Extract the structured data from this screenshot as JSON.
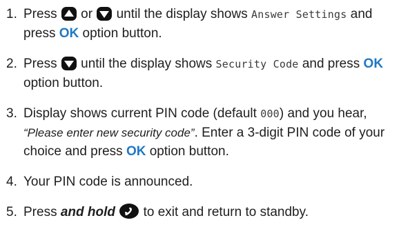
{
  "colors": {
    "accent": "#1f78c4",
    "text": "#1e1e1e",
    "icon": "#111111"
  },
  "steps": [
    {
      "number": "1.",
      "t1": "Press",
      "icon1": "up-arrow-icon",
      "t2": "or",
      "icon2": "down-arrow-icon",
      "t3": "until the display shows",
      "lcd": "Answer Settings",
      "t4": "and press",
      "ok": "OK",
      "t5": "option button."
    },
    {
      "number": "2.",
      "t1": "Press",
      "icon1": "down-arrow-icon",
      "t2": "until the display shows",
      "lcd": "Security Code",
      "t3": "and press",
      "ok": "OK",
      "t4": "option button."
    },
    {
      "number": "3.",
      "t1": "Display shows current PIN code (default",
      "lcd": "000",
      "t2": ") and you hear,",
      "quote": "“Please enter new security code”",
      "t3": ". Enter a 3-digit PIN code of your choice and press",
      "ok": "OK",
      "t4": "option button."
    },
    {
      "number": "4.",
      "t1": "Your PIN code is announced."
    },
    {
      "number": "5.",
      "t1": "Press",
      "em": "and hold",
      "icon1": "phone-icon",
      "t2": "to exit and return to standby."
    }
  ]
}
